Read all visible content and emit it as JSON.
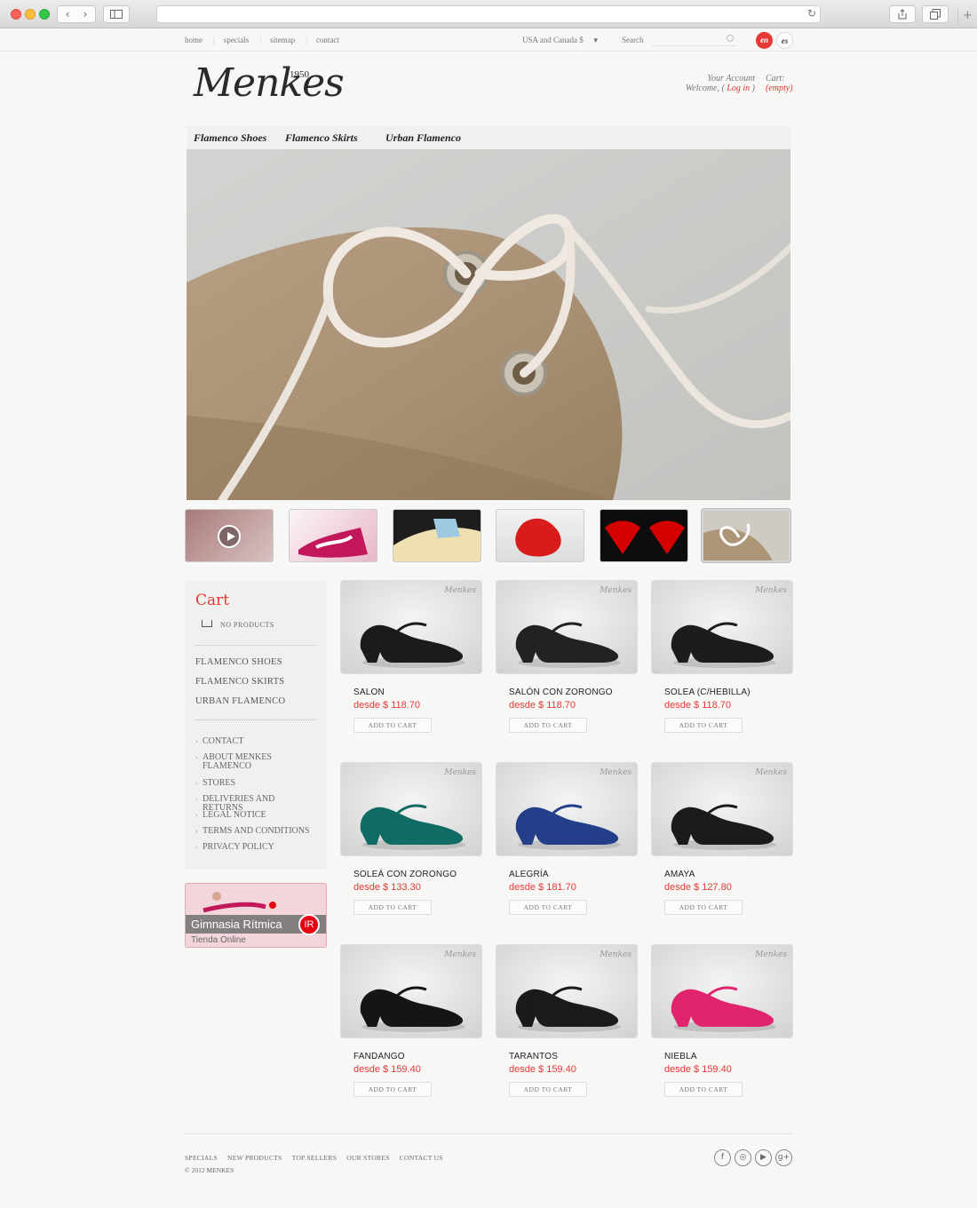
{
  "browser": {
    "back_icon": "‹",
    "forward_icon": "›",
    "reload_icon": "↻",
    "plus_icon": "+"
  },
  "topbar": {
    "links": [
      "home",
      "specials",
      "sitemap",
      "contact"
    ],
    "region": "USA and Canada $",
    "search_label": "Search",
    "lang_en": "en",
    "lang_es": "es"
  },
  "header": {
    "logo": "Menkes",
    "logo_year": "1950",
    "account_label": "Your Account",
    "welcome": "Welcome, (",
    "login": "Log in",
    "close_paren": ")",
    "cart_label": "Cart:",
    "cart_status": "(empty)"
  },
  "mainnav": [
    "Flamenco Shoes",
    "Flamenco Skirts",
    "Urban Flamenco"
  ],
  "sidebar": {
    "cart_title": "Cart",
    "no_products": "NO PRODUCTS",
    "categories": [
      "FLAMENCO SHOES",
      "FLAMENCO SKIRTS",
      "URBAN FLAMENCO"
    ],
    "info_links": [
      "CONTACT",
      "ABOUT MENKES FLAMENCO",
      "STORES",
      "DELIVERIES AND RETURNS",
      "LEGAL NOTICE",
      "TERMS AND CONDITIONS",
      "PRIVACY POLICY"
    ]
  },
  "promo": {
    "title": "Gimnasia Rítmica",
    "subtitle": "Tienda Online",
    "badge": "IR"
  },
  "products": [
    {
      "name": "SALON",
      "price": "desde $ 118.70",
      "button": "ADD TO CART",
      "color": "#1b1b1b"
    },
    {
      "name": "SALÓN CON ZORONGO",
      "price": "desde $ 118.70",
      "button": "ADD TO CART",
      "color": "#222222"
    },
    {
      "name": "SOLEA (C/HEBILLA)",
      "price": "desde $ 118.70",
      "button": "ADD TO CART",
      "color": "#1c1c1c"
    },
    {
      "name": "SOLEÁ CON ZORONGO",
      "price": "desde $ 133.30",
      "button": "ADD TO CART",
      "color": "#0f6b63"
    },
    {
      "name": "ALEGRÍA",
      "price": "desde $ 181.70",
      "button": "ADD TO CART",
      "color": "#233f8a"
    },
    {
      "name": "AMAYA",
      "price": "desde $ 127.80",
      "button": "ADD TO CART",
      "color": "#1b1b1b"
    },
    {
      "name": "FANDANGO",
      "price": "desde $ 159.40",
      "button": "ADD TO CART",
      "color": "#151515"
    },
    {
      "name": "TARANTOS",
      "price": "desde $ 159.40",
      "button": "ADD TO CART",
      "color": "#1a1a1a"
    },
    {
      "name": "NIEBLA",
      "price": "desde $ 159.40",
      "button": "ADD TO CART",
      "color": "#e0246e"
    }
  ],
  "product_brand": "Menkes",
  "footer": {
    "links": [
      "SPECIALS",
      "NEW PRODUCTS",
      "TOP SELLERS",
      "OUR STORES",
      "CONTACT US"
    ],
    "copyright": "© 2012 MENKES",
    "social": [
      "f",
      "◎",
      "▶",
      "g+"
    ]
  },
  "colors": {
    "accent": "#e53935",
    "background": "#f7f7f6"
  }
}
